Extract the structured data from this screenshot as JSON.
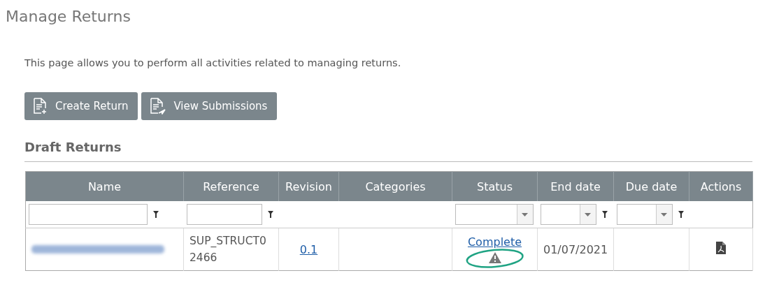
{
  "page_title": "Manage Returns",
  "description": "This page allows you to perform all activities related to managing returns.",
  "buttons": [
    {
      "label": "Create Return",
      "kind": "create"
    },
    {
      "label": "View Submissions",
      "kind": "submit"
    }
  ],
  "section_title": "Draft Returns",
  "table": {
    "columns": [
      {
        "label": "Name",
        "kind": "text"
      },
      {
        "label": "Reference",
        "kind": "text"
      },
      {
        "label": "Revision",
        "kind": "plain"
      },
      {
        "label": "Categories",
        "kind": "plain"
      },
      {
        "label": "Status",
        "kind": "select"
      },
      {
        "label": "End date",
        "kind": "select_filter"
      },
      {
        "label": "Due date",
        "kind": "select_filter"
      },
      {
        "label": "Actions",
        "kind": "plain"
      }
    ],
    "rows": [
      {
        "name_redacted": true,
        "reference": "SUP_STRUCT0 2466",
        "revision": "0.1",
        "status": "Complete",
        "status_warning": true,
        "warning_highlighted": true,
        "end_date": "01/07/2021",
        "pdf_action": true
      }
    ]
  }
}
